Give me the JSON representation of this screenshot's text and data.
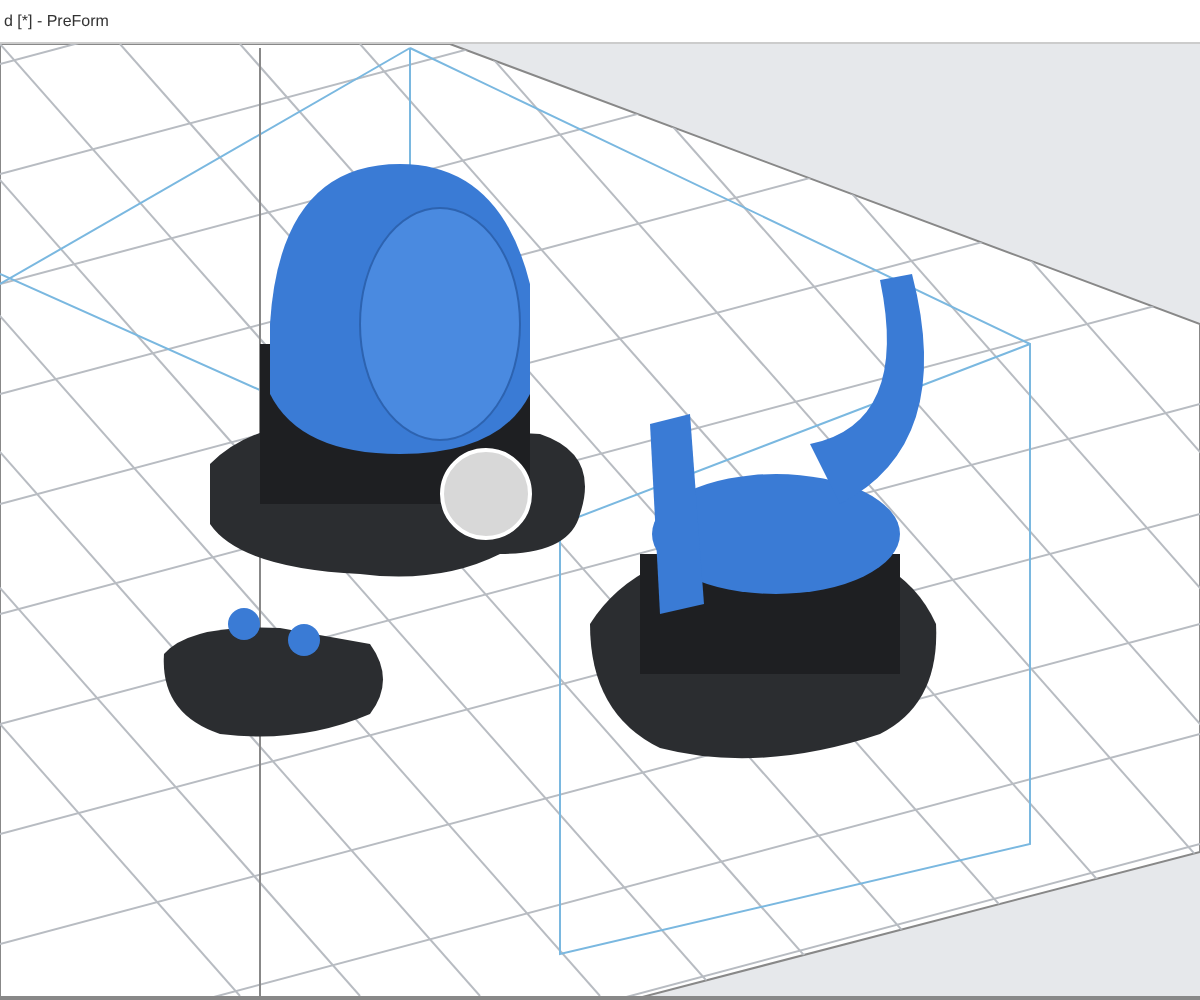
{
  "window": {
    "title": "d [*] - PreForm"
  }
}
